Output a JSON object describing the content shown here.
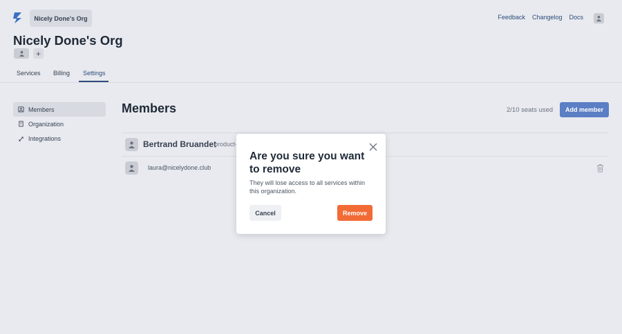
{
  "header": {
    "org_switcher": "Nicely Done's Org",
    "links": [
      "Feedback",
      "Changelog",
      "Docs"
    ]
  },
  "org": {
    "title": "Nicely Done's Org",
    "add_icon": "+"
  },
  "tabs": [
    {
      "label": "Services",
      "active": false
    },
    {
      "label": "Billing",
      "active": false
    },
    {
      "label": "Settings",
      "active": true
    }
  ],
  "sidebar": {
    "items": [
      {
        "label": "Members",
        "icon": "members-icon",
        "active": true
      },
      {
        "label": "Organization",
        "icon": "building-icon",
        "active": false
      },
      {
        "label": "Integrations",
        "icon": "rocket-icon",
        "active": false
      }
    ]
  },
  "members": {
    "title": "Members",
    "seats": "2/10 seats used",
    "add_button": "Add member",
    "rows": [
      {
        "name": "Bertrand Bruandet",
        "meta": "product-"
      },
      {
        "email": "laura@nicelydone.club"
      }
    ]
  },
  "modal": {
    "title": "Are you sure you want to remove",
    "body": "They will lose access to all services within this organization.",
    "cancel": "Cancel",
    "remove": "Remove"
  },
  "colors": {
    "background": "#e8eaef",
    "accent": "#2d4a7a",
    "primary_button": "#5b7ec4",
    "danger": "#f26a35"
  }
}
